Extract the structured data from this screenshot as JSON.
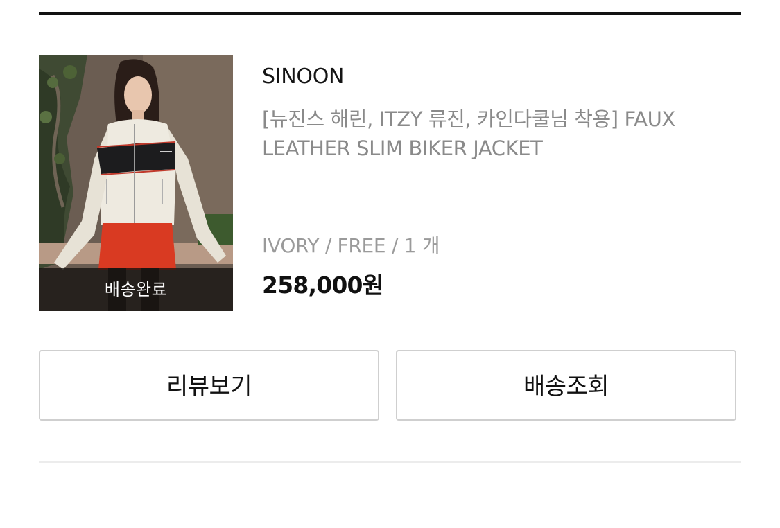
{
  "order_item": {
    "status_label": "배송완료",
    "brand": "SINOON",
    "product_name": "[뉴진스 해린, ITZY 류진, 카인다쿨님 착용] FAUX LEATHER SLIM BIKER JACKET",
    "option": "IVORY / FREE / 1 개",
    "price": "258,000원",
    "image_icon": "product-photo"
  },
  "actions": {
    "review_label": "리뷰보기",
    "tracking_label": "배송조회"
  },
  "colors": {
    "text_primary": "#111111",
    "text_secondary": "#8a8a8a",
    "border": "#cfcfcf",
    "divider": "#ececec"
  }
}
